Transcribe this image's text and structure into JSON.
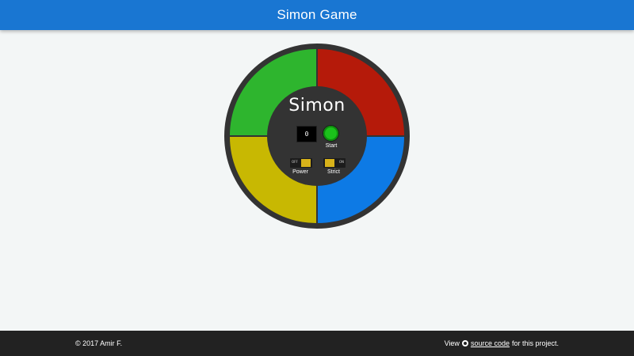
{
  "header": {
    "title": "Simon Game"
  },
  "game": {
    "logo": "Simon",
    "count_display": "0",
    "start_label": "Start",
    "power": {
      "label": "Power",
      "state_text": "OFF",
      "state": "off"
    },
    "strict": {
      "label": "Strict",
      "state_text": "ON",
      "state": "off"
    },
    "pads": {
      "green": "#2eb52e",
      "red": "#b51a0a",
      "yellow": "#c8b802",
      "blue": "#0d7ae5"
    },
    "start_button_color": "#1bc21b"
  },
  "footer": {
    "copyright": "© 2017 Amir F.",
    "view_prefix": "View",
    "source_link": "source code",
    "view_suffix": "for this project."
  }
}
